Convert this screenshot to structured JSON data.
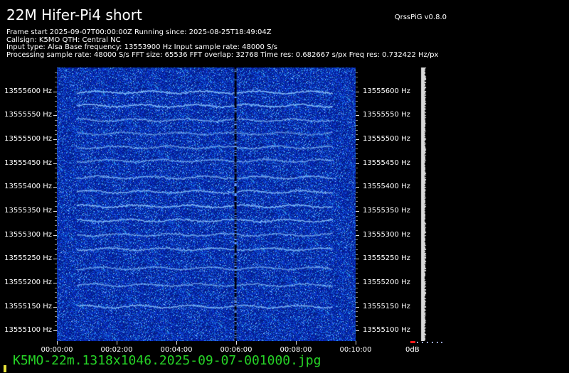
{
  "window": {
    "title": "22M Hifer-Pi4 short",
    "version": "QrssPiG v0.8.0"
  },
  "info_lines": [
    "Frame start 2025-09-07T00:00:00Z Running since: 2025-08-25T18:49:04Z",
    "Callsign: K5MO QTH: Central NC",
    "Input type: Alsa Base frequency: 13553900 Hz Input sample rate: 48000 S/s",
    "Processing sample rate: 48000 S/s FFT size: 65536 FFT overlap: 32768 Time res: 0.682667 s/px Freq res: 0.732422 Hz/px"
  ],
  "freq_axis": {
    "labels": [
      "13555600 Hz",
      "13555550 Hz",
      "13555500 Hz",
      "13555450 Hz",
      "13555400 Hz",
      "13555350 Hz",
      "13555300 Hz",
      "13555250 Hz",
      "13555200 Hz",
      "13555150 Hz",
      "13555100 Hz"
    ],
    "values": [
      13555600,
      13555550,
      13555500,
      13555450,
      13555400,
      13555350,
      13555300,
      13555250,
      13555200,
      13555150,
      13555100
    ],
    "min": 13555078,
    "max": 13555650
  },
  "time_axis": {
    "labels": [
      "00:00:00",
      "00:02:00",
      "00:04:00",
      "00:06:00",
      "00:08:00",
      "00:10:00"
    ],
    "values": [
      0,
      120,
      240,
      360,
      480,
      600
    ],
    "min": 0,
    "max": 600
  },
  "signal_traces": {
    "freqs": [
      13555598,
      13555570,
      13555540,
      13555512,
      13555483,
      13555455,
      13555420,
      13555390,
      13555360,
      13555330,
      13555300,
      13555270,
      13555230,
      13555195,
      13555150
    ],
    "time_start": 40,
    "time_end": 555
  },
  "marker_time": 358,
  "db_label": "0dB",
  "filename": "K5MO-22m.1318x1046.2025-09-07-001000.jpg",
  "colors": {
    "background": "#000000",
    "spectrogram_base": "#061da6",
    "signal": "#8ec8ff",
    "text": "#ffffff",
    "filename": "#26d326"
  }
}
